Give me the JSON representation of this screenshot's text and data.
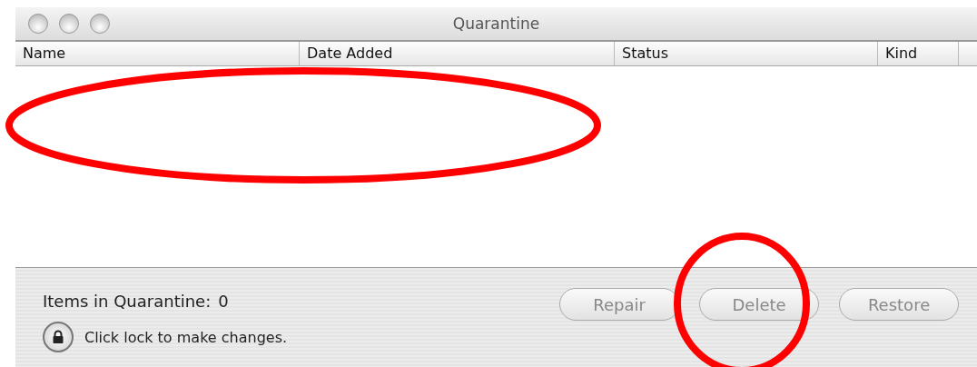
{
  "window": {
    "title": "Quarantine"
  },
  "table": {
    "columns": [
      "Name",
      "Date Added",
      "Status",
      "Kind"
    ]
  },
  "footer": {
    "count_label": "Items in Quarantine:",
    "count": "0",
    "lock_text": "Click lock to make changes."
  },
  "buttons": [
    {
      "label": "Repair",
      "disabled": true
    },
    {
      "label": "Delete",
      "disabled": true
    },
    {
      "label": "Restore",
      "disabled": true
    }
  ],
  "annotations": [
    {
      "kind": "ellipse"
    },
    {
      "kind": "circle"
    }
  ]
}
